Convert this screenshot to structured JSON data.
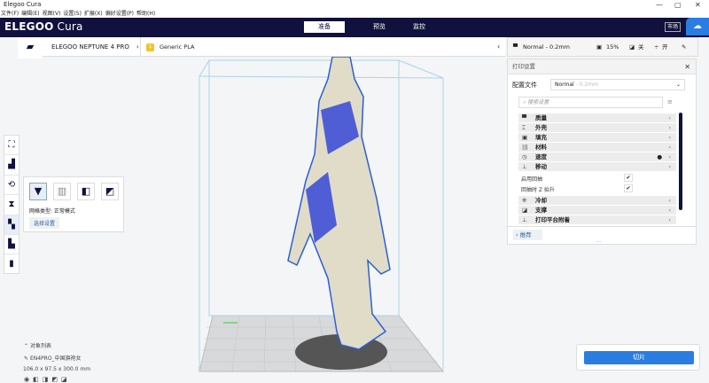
{
  "window": {
    "title": "Elegoo Cura",
    "minimize": "—",
    "maximize": "▢",
    "close": "✕"
  },
  "menu": [
    "文件(F)",
    "编辑(E)",
    "视图(V)",
    "设置(S)",
    "扩展(X)",
    "偏好设置(P)",
    "帮助(H)"
  ],
  "header": {
    "logo_main": "ELEGOO",
    "logo_sub": " Cura",
    "tabs": [
      "准备",
      "预览",
      "监控"
    ],
    "active_tab": 0,
    "market": "市场"
  },
  "stage": {
    "printer": "ELEGOO NEPTUNE 4 PRO",
    "material": "Generic PLA"
  },
  "summary": {
    "profile": "Normal - 0.2mm",
    "infill": "15%",
    "support": "关",
    "adhesion": "开"
  },
  "print_settings": {
    "title": "打印设置",
    "profile_label": "配置文件",
    "profile_value": "Normal",
    "profile_suffix": " - 0.2mm",
    "search_placeholder": "搜索设置",
    "categories": [
      {
        "label": "质量",
        "icon": "▀"
      },
      {
        "label": "外壳",
        "icon": "⌶"
      },
      {
        "label": "填充",
        "icon": "▣"
      },
      {
        "label": "材料",
        "icon": "|||"
      },
      {
        "label": "速度",
        "icon": "◷"
      },
      {
        "label": "移动",
        "icon": "⊥"
      }
    ],
    "travel_settings": [
      {
        "label": "启用回抽",
        "checked": true
      },
      {
        "label": "回抽时 Z 抬升",
        "checked": true
      }
    ],
    "categories2": [
      {
        "label": "冷却",
        "icon": "❊"
      },
      {
        "label": "支撑",
        "icon": "◪"
      },
      {
        "label": "打印平台附着",
        "icon": "⊥"
      }
    ],
    "recommended": "推荐"
  },
  "mesh_popup": {
    "type_label": "网格类型: 正常模式",
    "select_settings": "选择设置"
  },
  "objects": {
    "header": "对象列表",
    "name": "EN4PRO_中国旗袍女",
    "dimensions": "106.0 x 97.5 x 300.0 mm"
  },
  "slice_button": "切片"
}
